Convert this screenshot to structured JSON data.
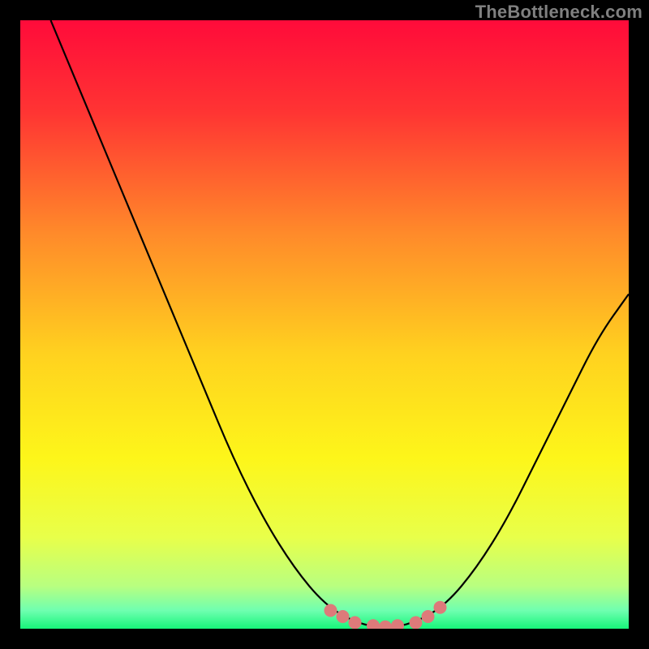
{
  "watermark": "TheBottleneck.com",
  "chart_data": {
    "type": "line",
    "title": "",
    "xlabel": "",
    "ylabel": "",
    "xlim": [
      0,
      100
    ],
    "ylim": [
      0,
      100
    ],
    "curve": {
      "name": "bottleneck-curve",
      "points": [
        {
          "x": 5,
          "y": 100
        },
        {
          "x": 10,
          "y": 88
        },
        {
          "x": 15,
          "y": 76
        },
        {
          "x": 20,
          "y": 64
        },
        {
          "x": 25,
          "y": 52
        },
        {
          "x": 30,
          "y": 40
        },
        {
          "x": 35,
          "y": 28
        },
        {
          "x": 40,
          "y": 18
        },
        {
          "x": 45,
          "y": 10
        },
        {
          "x": 50,
          "y": 4
        },
        {
          "x": 55,
          "y": 1
        },
        {
          "x": 60,
          "y": 0
        },
        {
          "x": 65,
          "y": 1
        },
        {
          "x": 70,
          "y": 4
        },
        {
          "x": 75,
          "y": 10
        },
        {
          "x": 80,
          "y": 18
        },
        {
          "x": 85,
          "y": 28
        },
        {
          "x": 90,
          "y": 38
        },
        {
          "x": 95,
          "y": 48
        },
        {
          "x": 100,
          "y": 55
        }
      ]
    },
    "markers": {
      "name": "optimal-range-markers",
      "color": "#dd7a7a",
      "points": [
        {
          "x": 51,
          "y": 3
        },
        {
          "x": 53,
          "y": 2
        },
        {
          "x": 55,
          "y": 1
        },
        {
          "x": 58,
          "y": 0.5
        },
        {
          "x": 60,
          "y": 0.3
        },
        {
          "x": 62,
          "y": 0.5
        },
        {
          "x": 65,
          "y": 1
        },
        {
          "x": 67,
          "y": 2
        },
        {
          "x": 69,
          "y": 3.5
        }
      ]
    },
    "gradient_stops": [
      {
        "offset": 0,
        "color": "#ff0b3a"
      },
      {
        "offset": 15,
        "color": "#ff3433"
      },
      {
        "offset": 35,
        "color": "#ff8a2a"
      },
      {
        "offset": 55,
        "color": "#ffd21f"
      },
      {
        "offset": 72,
        "color": "#fdf61a"
      },
      {
        "offset": 85,
        "color": "#e8ff4a"
      },
      {
        "offset": 93,
        "color": "#b8ff80"
      },
      {
        "offset": 97,
        "color": "#6fffb0"
      },
      {
        "offset": 100,
        "color": "#17f57a"
      }
    ]
  }
}
